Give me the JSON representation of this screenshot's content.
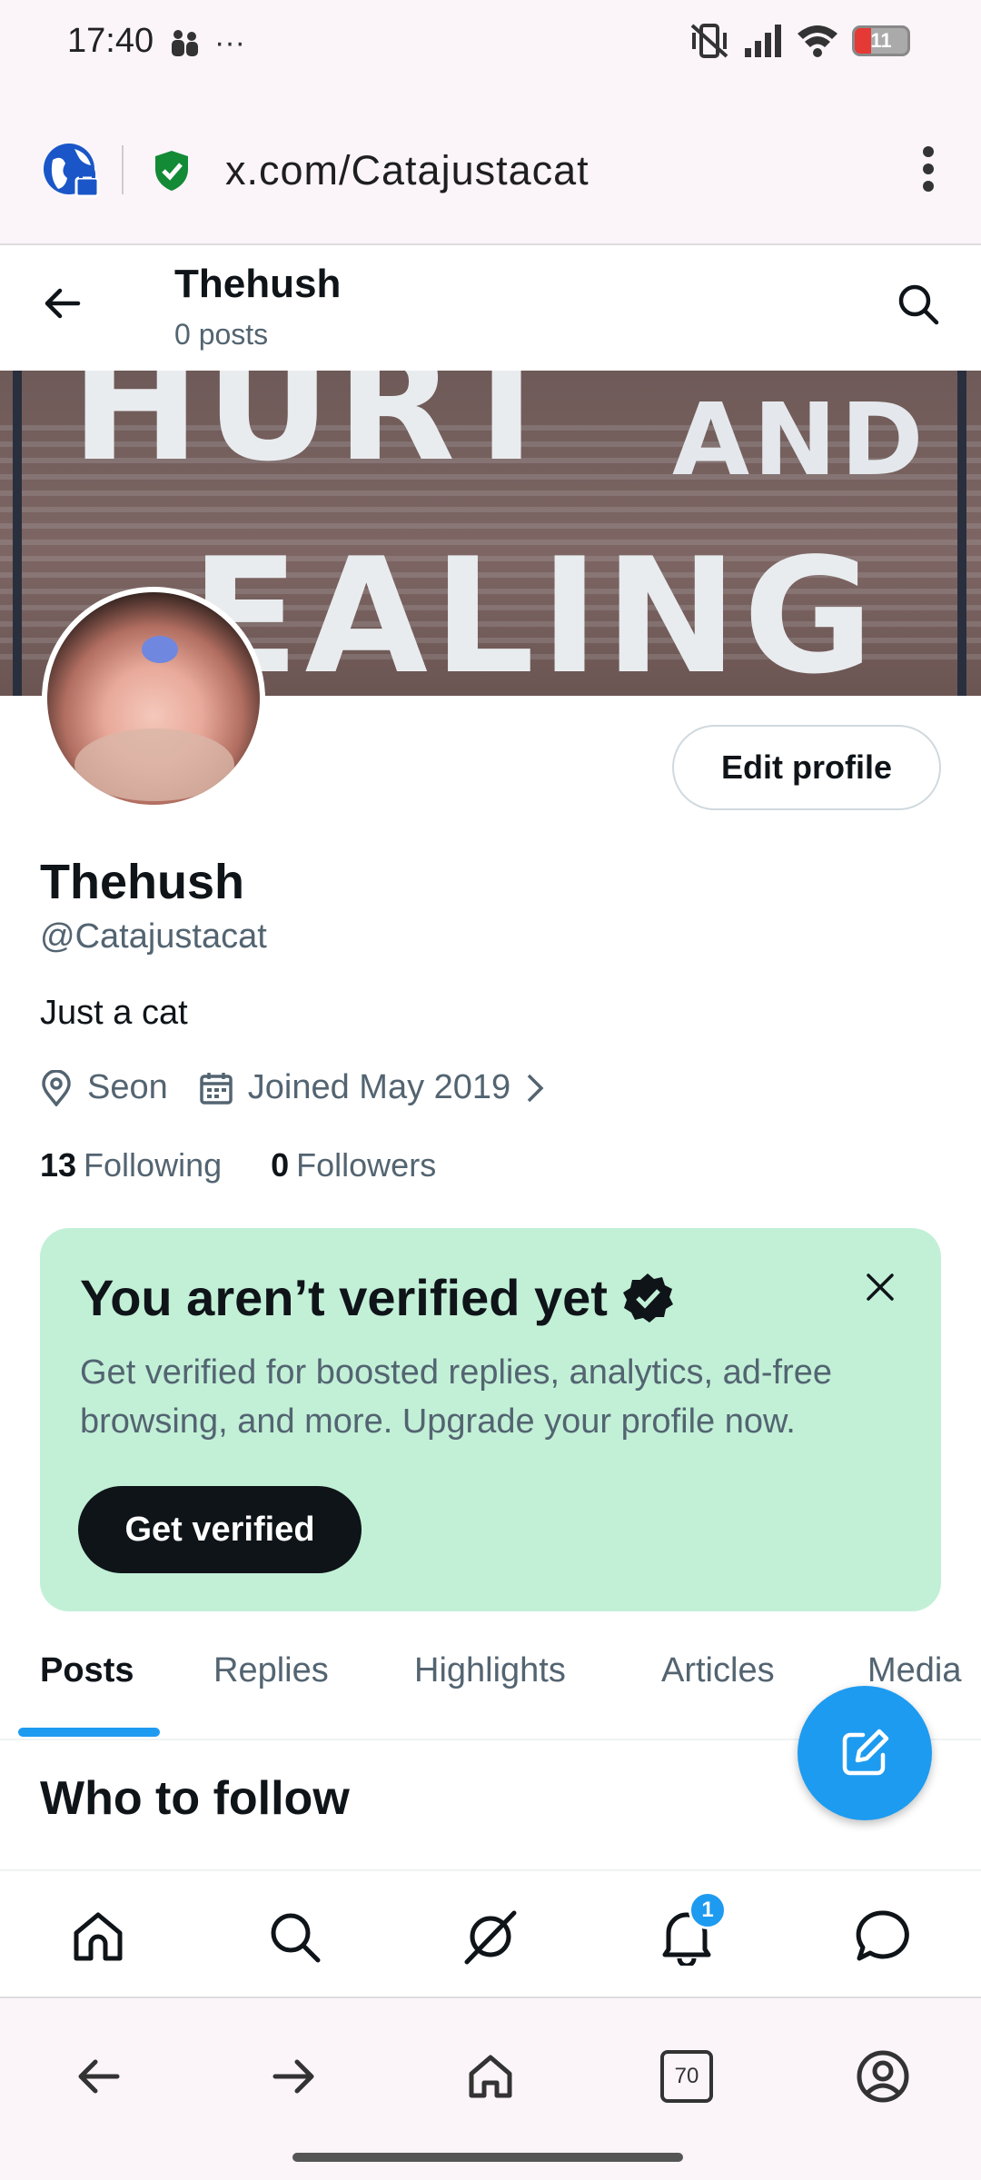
{
  "status_bar": {
    "time": "17:40",
    "more": "···",
    "battery": "11"
  },
  "browser": {
    "url": "x.com/Catajustacat",
    "tab_count": "70"
  },
  "header": {
    "name": "Thehush",
    "posts": "0 posts"
  },
  "banner": {
    "line1": "HURT",
    "line2": "AND",
    "line3": "EALING"
  },
  "profile": {
    "edit_button": "Edit profile",
    "display_name": "Thehush",
    "handle": "@Catajustacat",
    "bio": "Just a cat",
    "location": "Seon",
    "joined": "Joined May 2019",
    "following_count": "13",
    "following_label": "Following",
    "followers_count": "0",
    "followers_label": "Followers"
  },
  "verify_card": {
    "title": "You aren’t verified yet",
    "text": "Get verified for boosted replies, analytics, ad-free browsing, and more. Upgrade your profile now.",
    "button": "Get verified"
  },
  "tabs": [
    {
      "label": "Posts",
      "active": true
    },
    {
      "label": "Replies",
      "active": false
    },
    {
      "label": "Highlights",
      "active": false
    },
    {
      "label": "Articles",
      "active": false
    },
    {
      "label": "Media",
      "active": false
    }
  ],
  "who_to_follow": "Who to follow",
  "bottom_nav": {
    "notification_badge": "1"
  },
  "colors": {
    "accent": "#1d9bf0",
    "verify_bg": "#c2f0d7",
    "text_secondary": "#536471"
  },
  "icons": [
    "back-arrow-icon",
    "search-icon",
    "location-pin-icon",
    "calendar-icon",
    "chevron-right-icon",
    "close-icon",
    "verified-badge-icon",
    "compose-icon",
    "home-icon",
    "grok-icon",
    "bell-icon",
    "messages-icon"
  ]
}
